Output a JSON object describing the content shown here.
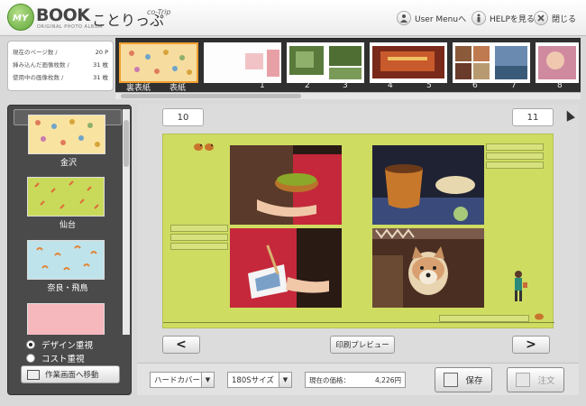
{
  "header": {
    "logo_my": "MY",
    "logo_book": "BOOK",
    "logo_sub": "ORIGINAL PHOTO ALBUM",
    "logo_jp": "ことりっぷ",
    "logo_co": "co-Trip",
    "user_menu": "User Menuへ",
    "help": "HELPを見る",
    "close": "閉じる"
  },
  "info": {
    "rows": [
      {
        "label": "現在のページ数 /",
        "value": "20 P"
      },
      {
        "label": "挿み込んだ画像枚数 /",
        "value": "31 枚"
      },
      {
        "label": "使用中の画像枚数 /",
        "value": "31 枚"
      }
    ]
  },
  "filmstrip": {
    "cover_back": "裏表紙",
    "cover_front": "表紙",
    "pages": [
      "1",
      "2",
      "3",
      "4",
      "5",
      "6",
      "7",
      "8"
    ]
  },
  "designs": [
    {
      "name": "金沢",
      "color": "#f9e3a0",
      "selected": true
    },
    {
      "name": "仙台",
      "color": "#c9d95a"
    },
    {
      "name": "奈良・飛鳥",
      "color": "#bfe3ea"
    },
    {
      "name": "",
      "color": "#f6b7bd"
    }
  ],
  "options": {
    "design_priority": "デザイン重視",
    "cost_priority": "コスト重視",
    "move_button": "作業画面へ移動"
  },
  "canvas": {
    "left_page": "10",
    "right_page": "11",
    "preview": "印刷プレビュー",
    "prev": "<",
    "next": ">",
    "bg_color": "#cfdc62"
  },
  "bottom": {
    "cover": "ハードカバー",
    "size": "180Sサイズ",
    "price_label": "現在の価格：",
    "price_value": "4,226円",
    "save": "保存",
    "order": "注文"
  }
}
